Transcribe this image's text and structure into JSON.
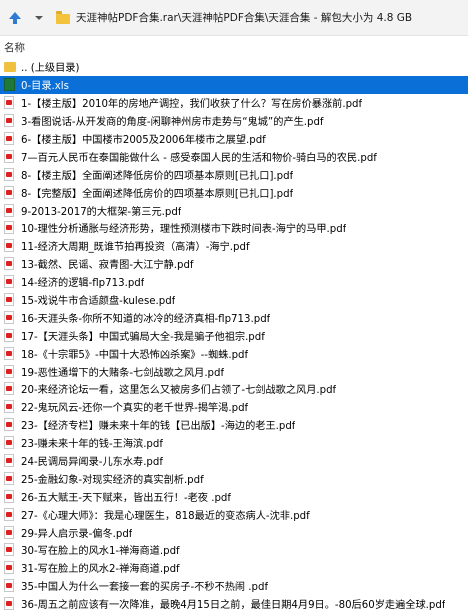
{
  "toolbar": {
    "path": "天涯神帖PDF合集.rar\\天涯神帖PDF合集\\天涯合集 - 解包大小为 4.8 GB"
  },
  "columns": {
    "name": "名称"
  },
  "rows": [
    {
      "icon": "up-folder-icon",
      "text": ".. (上级目录)"
    },
    {
      "icon": "xls-file-icon",
      "text": "0-目录.xls",
      "selected": true
    },
    {
      "icon": "pdf-file-icon",
      "text": "1-【楼主版】2010年的房地产调控，我们收获了什么？写在房价暴涨前.pdf"
    },
    {
      "icon": "pdf-file-icon",
      "text": "3-看图说话-从开发商的角度-闲聊神州房市走势与“鬼城”的产生.pdf"
    },
    {
      "icon": "pdf-file-icon",
      "text": "6-【楼主版】中国楼市2005及2006年楼市之展望.pdf"
    },
    {
      "icon": "pdf-file-icon",
      "text": "7—百元人民币在泰国能做什么 - 感受泰国人民的生活和物价-骑白马的农民.pdf"
    },
    {
      "icon": "pdf-file-icon",
      "text": "8-【楼主版】全面阐述降低房价的四项基本原则[已扎口].pdf"
    },
    {
      "icon": "pdf-file-icon",
      "text": "8-【完整版】全面阐述降低房价的四项基本原则[已扎口].pdf"
    },
    {
      "icon": "pdf-file-icon",
      "text": "9-2013-2017的大框架-第三元.pdf"
    },
    {
      "icon": "pdf-file-icon",
      "text": "10-理性分析通胀与经济形势，理性预测楼市下跌时间表-海宁的马甲.pdf"
    },
    {
      "icon": "pdf-file-icon",
      "text": "11-经济大周期_既谁节拍再投资（高清）-海宁.pdf"
    },
    {
      "icon": "pdf-file-icon",
      "text": "13-截然、民谣、寂青图-大江宁静.pdf"
    },
    {
      "icon": "pdf-file-icon",
      "text": "14-经济的逻辑-flp713.pdf"
    },
    {
      "icon": "pdf-file-icon",
      "text": "15-戏说牛市合适颜盘-kulese.pdf"
    },
    {
      "icon": "pdf-file-icon",
      "text": "16-天涯头条-你所不知道的冰冷的经济真相-flp713.pdf"
    },
    {
      "icon": "pdf-file-icon",
      "text": "17-【天涯头条】中国式骗局大全-我是骗子他祖宗.pdf"
    },
    {
      "icon": "pdf-file-icon",
      "text": "18-《十宗罪5》-中国十大恐怖凶杀案》--蜘蛛.pdf"
    },
    {
      "icon": "pdf-file-icon",
      "text": "19-恶性通增下的大赌条-七剑战歌之风月.pdf"
    },
    {
      "icon": "pdf-file-icon",
      "text": "20-来经济论坛一看，这里怎么又被房多们占领了-七剑战歌之风月.pdf"
    },
    {
      "icon": "pdf-file-icon",
      "text": "22-鬼玩风云-还你一个真实的老千世界-揭竿渴.pdf"
    },
    {
      "icon": "pdf-file-icon",
      "text": "23-【经济专栏】赚未来十年的钱【已出版】-海边的老王.pdf"
    },
    {
      "icon": "pdf-file-icon",
      "text": "23-赚未来十年的钱-王海滨.pdf"
    },
    {
      "icon": "pdf-file-icon",
      "text": "24-民调局异闻录-儿东水寿.pdf"
    },
    {
      "icon": "pdf-file-icon",
      "text": "25-金融幻象-对现实经济的真实剖析.pdf"
    },
    {
      "icon": "pdf-file-icon",
      "text": "26-五大赋王-天下赋来，皆出五行！-老夜 .pdf"
    },
    {
      "icon": "pdf-file-icon",
      "text": "27-《心理大师》：我是心理医生，818最近的变态病人-沈非.pdf"
    },
    {
      "icon": "pdf-file-icon",
      "text": "29-异人启示录-偏冬.pdf"
    },
    {
      "icon": "pdf-file-icon",
      "text": "30-写在脸上的风水1-禅海商道.pdf"
    },
    {
      "icon": "pdf-file-icon",
      "text": "31-写在脸上的风水2-禅海商道.pdf"
    },
    {
      "icon": "pdf-file-icon",
      "text": "35-中国人为什么一套接一套的买房子-不秒不热闹 .pdf"
    },
    {
      "icon": "pdf-file-icon",
      "text": "36-周五之前应该有一次降准，最晚4月15日之前，最佳日期4月9日。-80后60岁走遍全球.pdf"
    }
  ]
}
